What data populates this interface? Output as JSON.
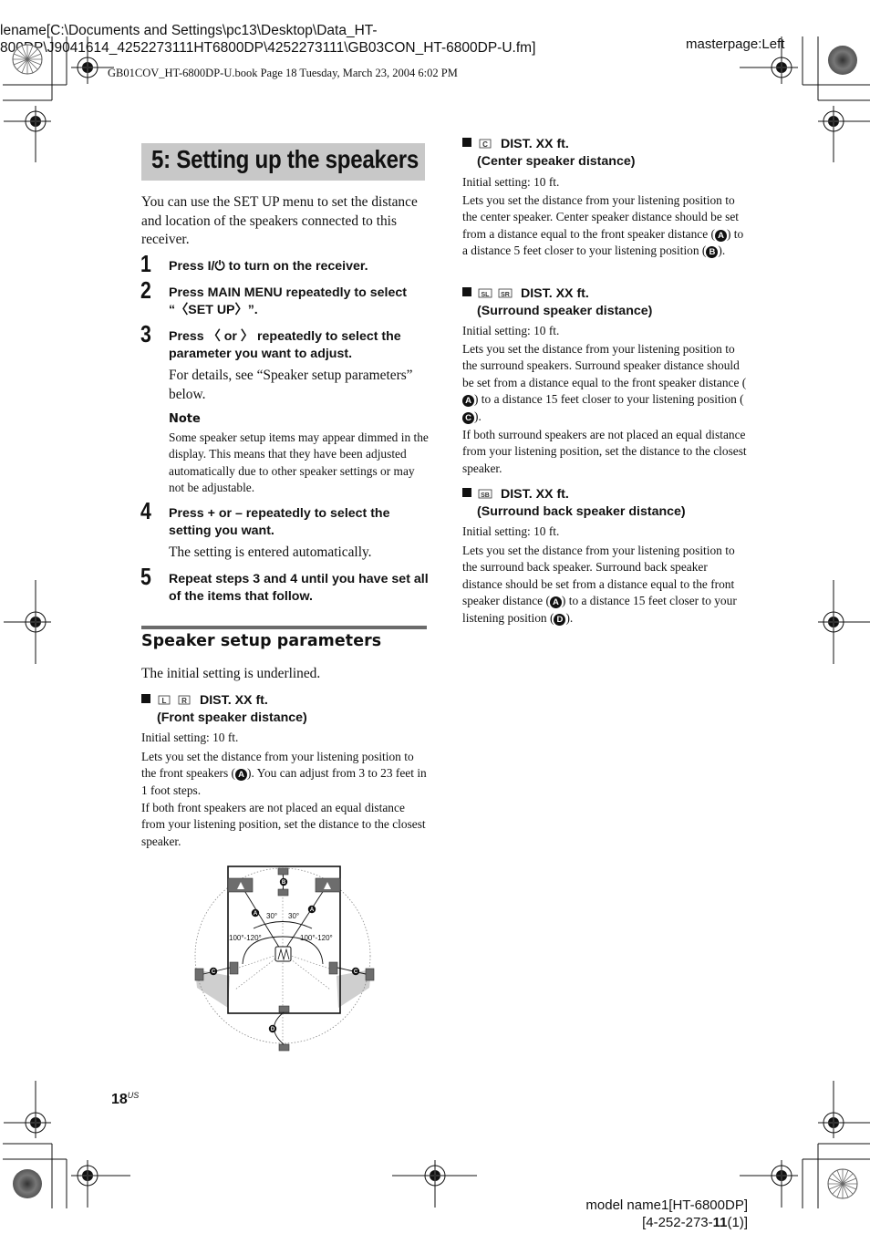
{
  "meta": {
    "filename_line1": "lename[C:\\Documents and Settings\\pc13\\Desktop\\Data_HT-",
    "filename_line2": "800DP\\J9041614_4252273111HT6800DP\\4252273111\\GB03CON_HT-6800DP-U.fm]",
    "masterpage": "masterpage:Left",
    "book_line": "GB01COV_HT-6800DP-U.book  Page 18  Tuesday, March 23, 2004  6:02 PM",
    "model_line1": "model name1[HT-6800DP]",
    "model_line2_prefix": "[4-252-273-",
    "model_line2_bold": "11",
    "model_line2_suffix": "(1)]"
  },
  "page": {
    "title": "5: Setting up the speakers",
    "intro": "You can use the SET UP menu to set the distance and location of the speakers connected to this receiver.",
    "steps": [
      {
        "num": "1",
        "text": "Press I/⏻ to turn on the receiver."
      },
      {
        "num": "2",
        "text": "Press MAIN MENU repeatedly to select “〈SET UP〉”."
      },
      {
        "num": "3",
        "text": "Press 〈 or 〉 repeatedly to select the parameter you want to adjust.",
        "detail": "For details, see “Speaker setup parameters” below."
      },
      {
        "num": "4",
        "text": "Press + or – repeatedly to select the setting you want.",
        "detail": "The setting is entered automatically."
      },
      {
        "num": "5",
        "text": "Repeat steps 3 and 4 until you have set all of the items that follow."
      }
    ],
    "note": {
      "label": "Note",
      "text": "Some speaker setup items may appear dimmed in the display. This means that they have been adjusted automatically due to other speaker settings or may not be adjustable."
    },
    "section_title": "Speaker setup parameters",
    "section_intro": "The initial setting is underlined.",
    "page_number": "18",
    "page_suffix": "US"
  },
  "params": [
    {
      "icons": [
        "L",
        "R"
      ],
      "head": "DIST. XX ft.",
      "sub": "(Front speaker distance)",
      "initial": "Initial setting: 10 ft.",
      "p1a": "Lets you set the distance from your listening position to the front speakers (",
      "p1mark": "A",
      "p1b": "). You can adjust from 3 to 23 feet in 1 foot steps.",
      "p2": "If both front speakers are not placed an equal distance from your listening position, set the distance to the closest speaker."
    },
    {
      "icons": [
        "C"
      ],
      "head": "DIST. XX ft.",
      "sub": "(Center speaker distance)",
      "initial": "Initial setting: 10 ft.",
      "p1a": "Lets you set the distance from your listening position to the center speaker. Center speaker distance should be set from a distance equal to the front speaker distance (",
      "p1mark": "A",
      "p1b": ") to a distance 5 feet closer to your listening position (",
      "p1mark2": "B",
      "p1c": ")."
    },
    {
      "icons": [
        "SL",
        "SR"
      ],
      "head": "DIST. XX ft.",
      "sub": "(Surround speaker distance)",
      "initial": "Initial setting: 10 ft.",
      "p1a": "Lets you set the distance from your listening position to the surround speakers. Surround speaker distance should be set from a distance equal to the front speaker distance (",
      "p1mark": "A",
      "p1b": ") to a distance 15 feet closer to your listening position (",
      "p1mark2": "C",
      "p1c": ").",
      "p2": "If both surround speakers are not placed an equal distance from your listening position, set the distance to the closest speaker."
    },
    {
      "icons": [
        "SB"
      ],
      "head": "DIST. XX ft.",
      "sub": "(Surround back speaker distance)",
      "initial": "Initial setting: 10 ft.",
      "p1a": "Lets you set the distance from your listening position to the surround back speaker. Surround back speaker distance should be set from a distance equal to the front speaker distance (",
      "p1mark": "A",
      "p1b": ") to a distance 15 feet closer to your listening position (",
      "p1mark2": "D",
      "p1c": ")."
    }
  ],
  "diagram": {
    "labels": {
      "a": "A",
      "b": "B",
      "c": "C",
      "d": "D"
    },
    "angle_front": "30°",
    "angle_surround": "100°-120°",
    "colors": {
      "speaker": "#6d6d6d",
      "shade": "#cfcfcf",
      "ink": "#111111"
    }
  }
}
